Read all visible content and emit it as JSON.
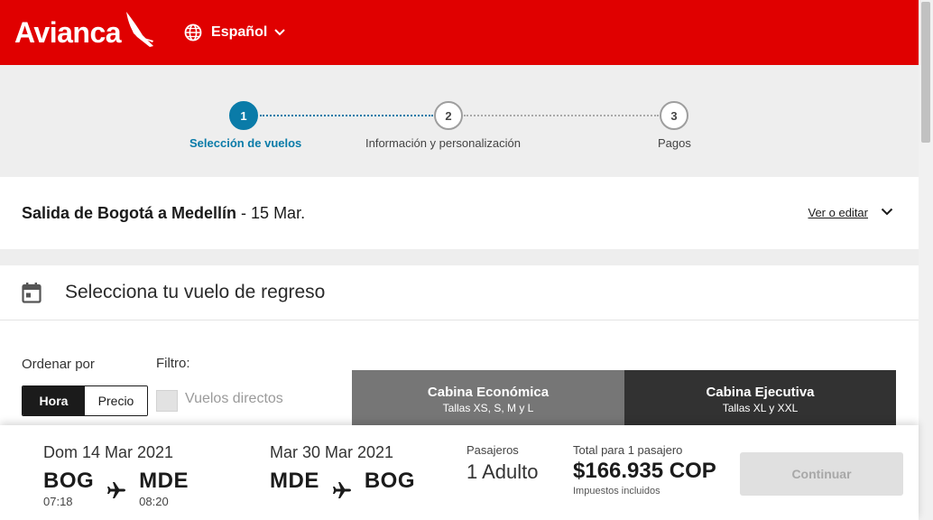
{
  "header": {
    "brand": "Avianca",
    "language": "Español"
  },
  "stepper": {
    "steps": [
      {
        "number": "1",
        "label": "Selección de vuelos"
      },
      {
        "number": "2",
        "label": "Información y personalización"
      },
      {
        "number": "3",
        "label": "Pagos"
      }
    ]
  },
  "outbound": {
    "title_bold": "Salida de Bogotá a Medellín",
    "title_rest": " - 15 Mar.",
    "edit_label": "Ver o editar"
  },
  "return_section": {
    "title": "Selecciona tu vuelo de regreso",
    "sort_label": "Ordenar por",
    "sort_options": [
      "Hora",
      "Precio"
    ],
    "filter_label": "Filtro:",
    "direct_label": "Vuelos directos",
    "cabins": [
      {
        "name": "Cabina Económica",
        "sub": "Tallas XS, S, M y L"
      },
      {
        "name": "Cabina Ejecutiva",
        "sub": "Tallas XL y XXL"
      }
    ]
  },
  "summary": {
    "outbound_leg": {
      "date": "Dom 14 Mar 2021",
      "from": "BOG",
      "to": "MDE",
      "depart": "07:18",
      "arrive": "08:20"
    },
    "return_leg": {
      "date": "Mar 30 Mar 2021",
      "from": "MDE",
      "to": "BOG"
    },
    "passengers_label": "Pasajeros",
    "passengers_value": "1 Adulto",
    "total_label": "Total para 1 pasajero",
    "total_value": "$166.935 COP",
    "tax_label": "Impuestos incluidos",
    "continue_label": "Continuar"
  },
  "colors": {
    "brand_red": "#e00000",
    "step_active": "#0a7ba8",
    "cabin_economy": "#767676",
    "cabin_executive": "#323232"
  },
  "icons": [
    "globe-icon",
    "chevron-down-icon",
    "calendar-icon",
    "plane-icon"
  ]
}
